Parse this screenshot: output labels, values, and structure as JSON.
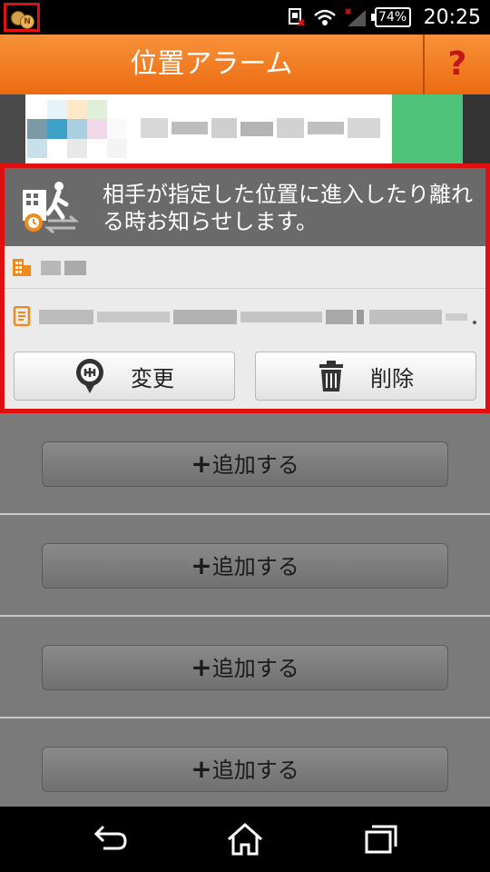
{
  "status_bar": {
    "app_badge_letter": "N",
    "battery": "74%",
    "time": "20:25"
  },
  "header": {
    "title": "位置アラーム",
    "help_label": "?"
  },
  "alarm": {
    "description": "相手が指定した位置に進入したり離れる時お知らせします。",
    "change_label": "変更",
    "delete_label": "削除"
  },
  "add_items": [
    {
      "label": "追加する"
    },
    {
      "label": "追加する"
    },
    {
      "label": "追加する"
    },
    {
      "label": "追加する"
    }
  ],
  "colors": {
    "header_orange": "#ec6b12",
    "highlight_red": "#e01010",
    "help_red": "#c41616",
    "icon_orange": "#f08a1a"
  },
  "icons": {
    "app": "coins-icon",
    "sim": "no-sim-icon",
    "wifi": "wifi-icon",
    "signal": "signal-icon",
    "building": "building-icon",
    "address": "address-icon",
    "change": "map-pin-icon",
    "delete": "trash-icon",
    "back": "back-icon",
    "home": "home-icon",
    "recents": "recents-icon"
  }
}
